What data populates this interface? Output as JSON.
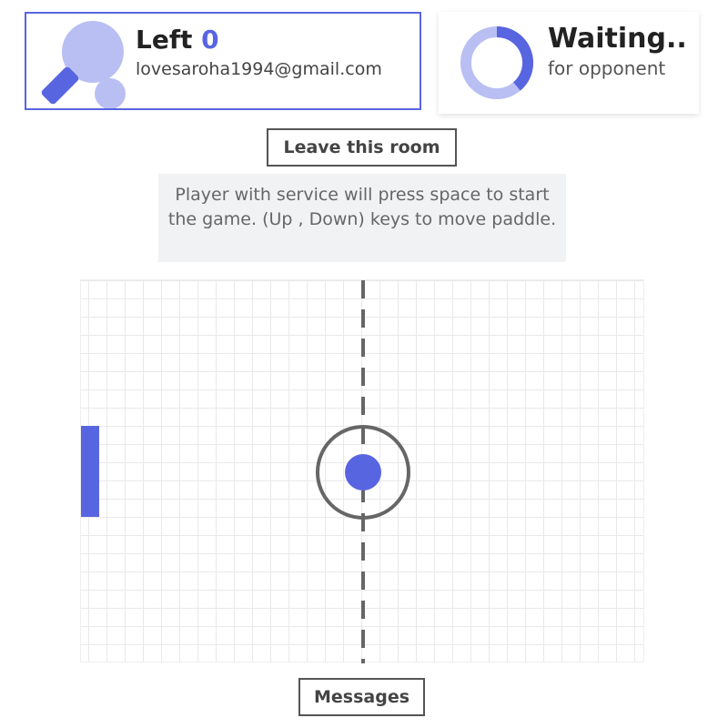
{
  "player": {
    "title": "Left",
    "score": "0",
    "email": "lovesaroha1994@gmail.com",
    "icon": "ping-pong-paddle-icon"
  },
  "opponent": {
    "title": "Waiting..",
    "subtitle": "for opponent",
    "icon": "loading-spinner-icon"
  },
  "actions": {
    "leave_label": "Leave this room",
    "messages_label": "Messages"
  },
  "instructions": "Player with service will press space to start the game. (Up , Down) keys to move paddle.",
  "game": {
    "left_paddle_position": "middle",
    "ball_position": "center"
  },
  "colors": {
    "accent": "#5865e0",
    "accent_light": "#b9bff3",
    "court_line": "#666666",
    "grid": "#e9e9e9",
    "panel_bg": "#f1f2f4"
  }
}
